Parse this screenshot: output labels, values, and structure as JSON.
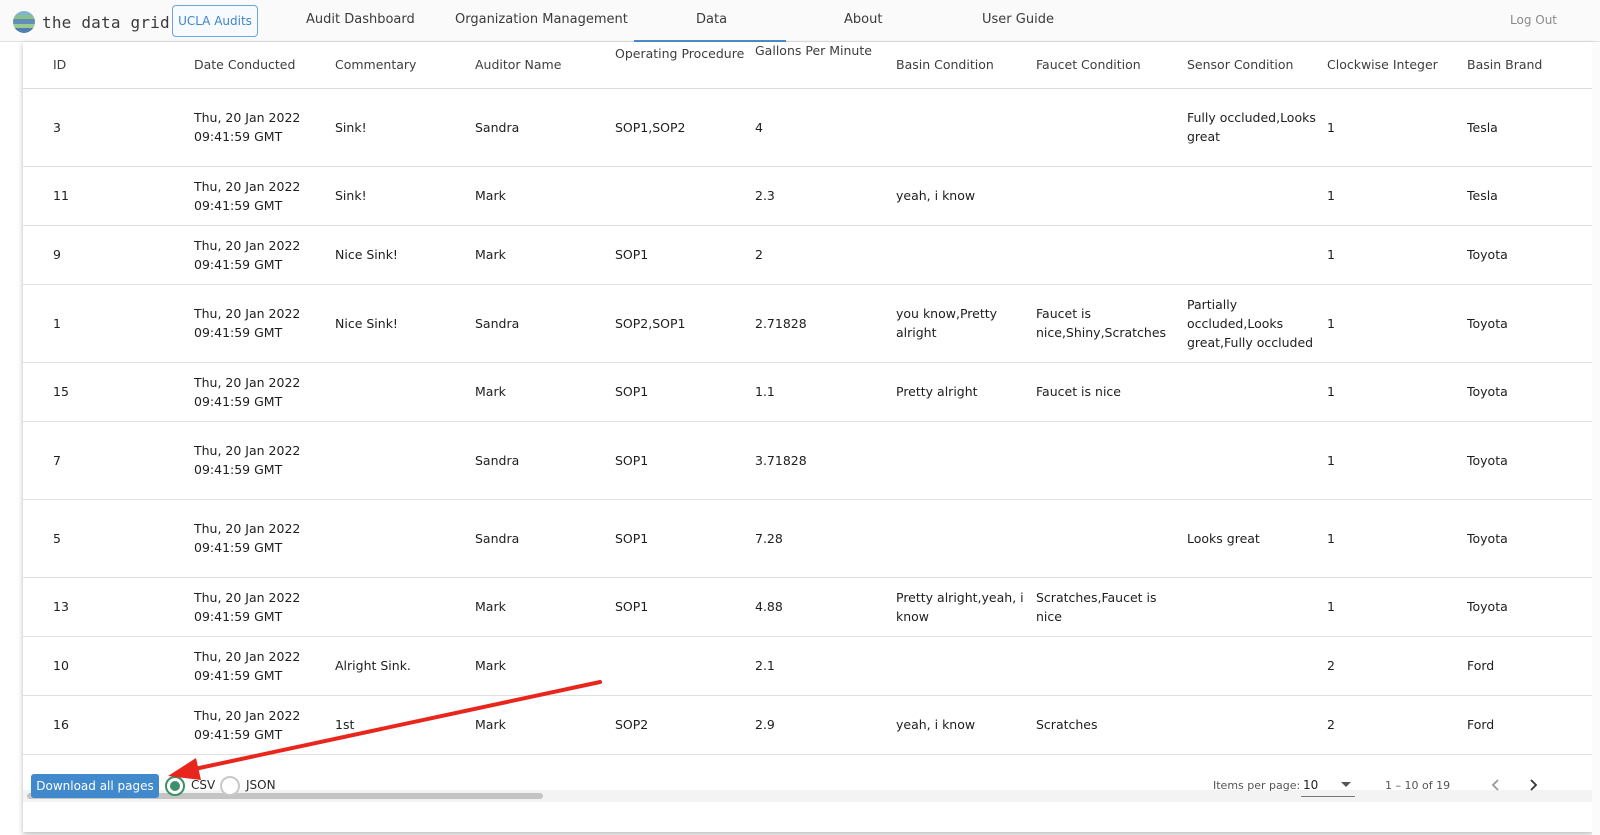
{
  "brand": {
    "name": "the data grid"
  },
  "org_button": {
    "label": "UCLA Audits"
  },
  "nav": [
    {
      "label": "Audit Dashboard"
    },
    {
      "label": "Organization Management"
    },
    {
      "label": "Data"
    },
    {
      "label": "About"
    },
    {
      "label": "User Guide"
    }
  ],
  "logout": {
    "label": "Log Out"
  },
  "table": {
    "headers": [
      "ID",
      "Date Conducted",
      "Commentary",
      "Auditor Name",
      "Operating Procedure",
      "Gallons Per Minute",
      "Basin Condition",
      "Faucet Condition",
      "Sensor Condition",
      "Clockwise Integer",
      "Basin Brand"
    ],
    "rows": [
      [
        "3",
        "Thu, 20 Jan 2022 09:41:59 GMT",
        "Sink!",
        "Sandra",
        "SOP1,SOP2",
        "4",
        "",
        "",
        "Fully occluded,Looks great",
        "1",
        "Tesla"
      ],
      [
        "11",
        "Thu, 20 Jan 2022 09:41:59 GMT",
        "Sink!",
        "Mark",
        "",
        "2.3",
        "yeah, i know",
        "",
        "",
        "1",
        "Tesla"
      ],
      [
        "9",
        "Thu, 20 Jan 2022 09:41:59 GMT",
        "Nice Sink!",
        "Mark",
        "SOP1",
        "2",
        "",
        "",
        "",
        "1",
        "Toyota"
      ],
      [
        "1",
        "Thu, 20 Jan 2022 09:41:59 GMT",
        "Nice Sink!",
        "Sandra",
        "SOP2,SOP1",
        "2.71828",
        "you know,Pretty alright",
        "Faucet is nice,Shiny,Scratches",
        "Partially occluded,Looks great,Fully occluded",
        "1",
        "Toyota"
      ],
      [
        "15",
        "Thu, 20 Jan 2022 09:41:59 GMT",
        "",
        "Mark",
        "SOP1",
        "1.1",
        "Pretty alright",
        "Faucet is nice",
        "",
        "1",
        "Toyota"
      ],
      [
        "7",
        "Thu, 20 Jan 2022 09:41:59 GMT",
        "",
        "Sandra",
        "SOP1",
        "3.71828",
        "",
        "",
        "",
        "1",
        "Toyota"
      ],
      [
        "5",
        "Thu, 20 Jan 2022 09:41:59 GMT",
        "",
        "Sandra",
        "SOP1",
        "7.28",
        "",
        "",
        "Looks great",
        "1",
        "Toyota"
      ],
      [
        "13",
        "Thu, 20 Jan 2022 09:41:59 GMT",
        "",
        "Mark",
        "SOP1",
        "4.88",
        "Pretty alright,yeah, i know",
        "Scratches,Faucet is nice",
        "",
        "1",
        "Toyota"
      ],
      [
        "10",
        "Thu, 20 Jan 2022 09:41:59 GMT",
        "Alright Sink.",
        "Mark",
        "",
        "2.1",
        "",
        "",
        "",
        "2",
        "Ford"
      ],
      [
        "16",
        "Thu, 20 Jan 2022 09:41:59 GMT",
        "1st",
        "Mark",
        "SOP2",
        "2.9",
        "yeah, i know",
        "Scratches",
        "",
        "2",
        "Ford"
      ]
    ]
  },
  "footer": {
    "download_label": "Download all pages",
    "formats": [
      {
        "label": "CSV",
        "selected": true
      },
      {
        "label": "JSON",
        "selected": false
      }
    ],
    "items_per_page_label": "Items per page:",
    "items_per_page_value": "10",
    "range_label": "1 – 10 of 19"
  },
  "icons": {
    "logo": "globe-logo-icon",
    "select_caret": "caret-down-icon",
    "prev": "chevron-left-icon",
    "next": "chevron-right-icon",
    "annotation": "red-arrow-annotation"
  },
  "colors": {
    "accent": "#4089cd",
    "radio_selected": "#3c8f69",
    "annotation_arrow": "#e8261c"
  }
}
